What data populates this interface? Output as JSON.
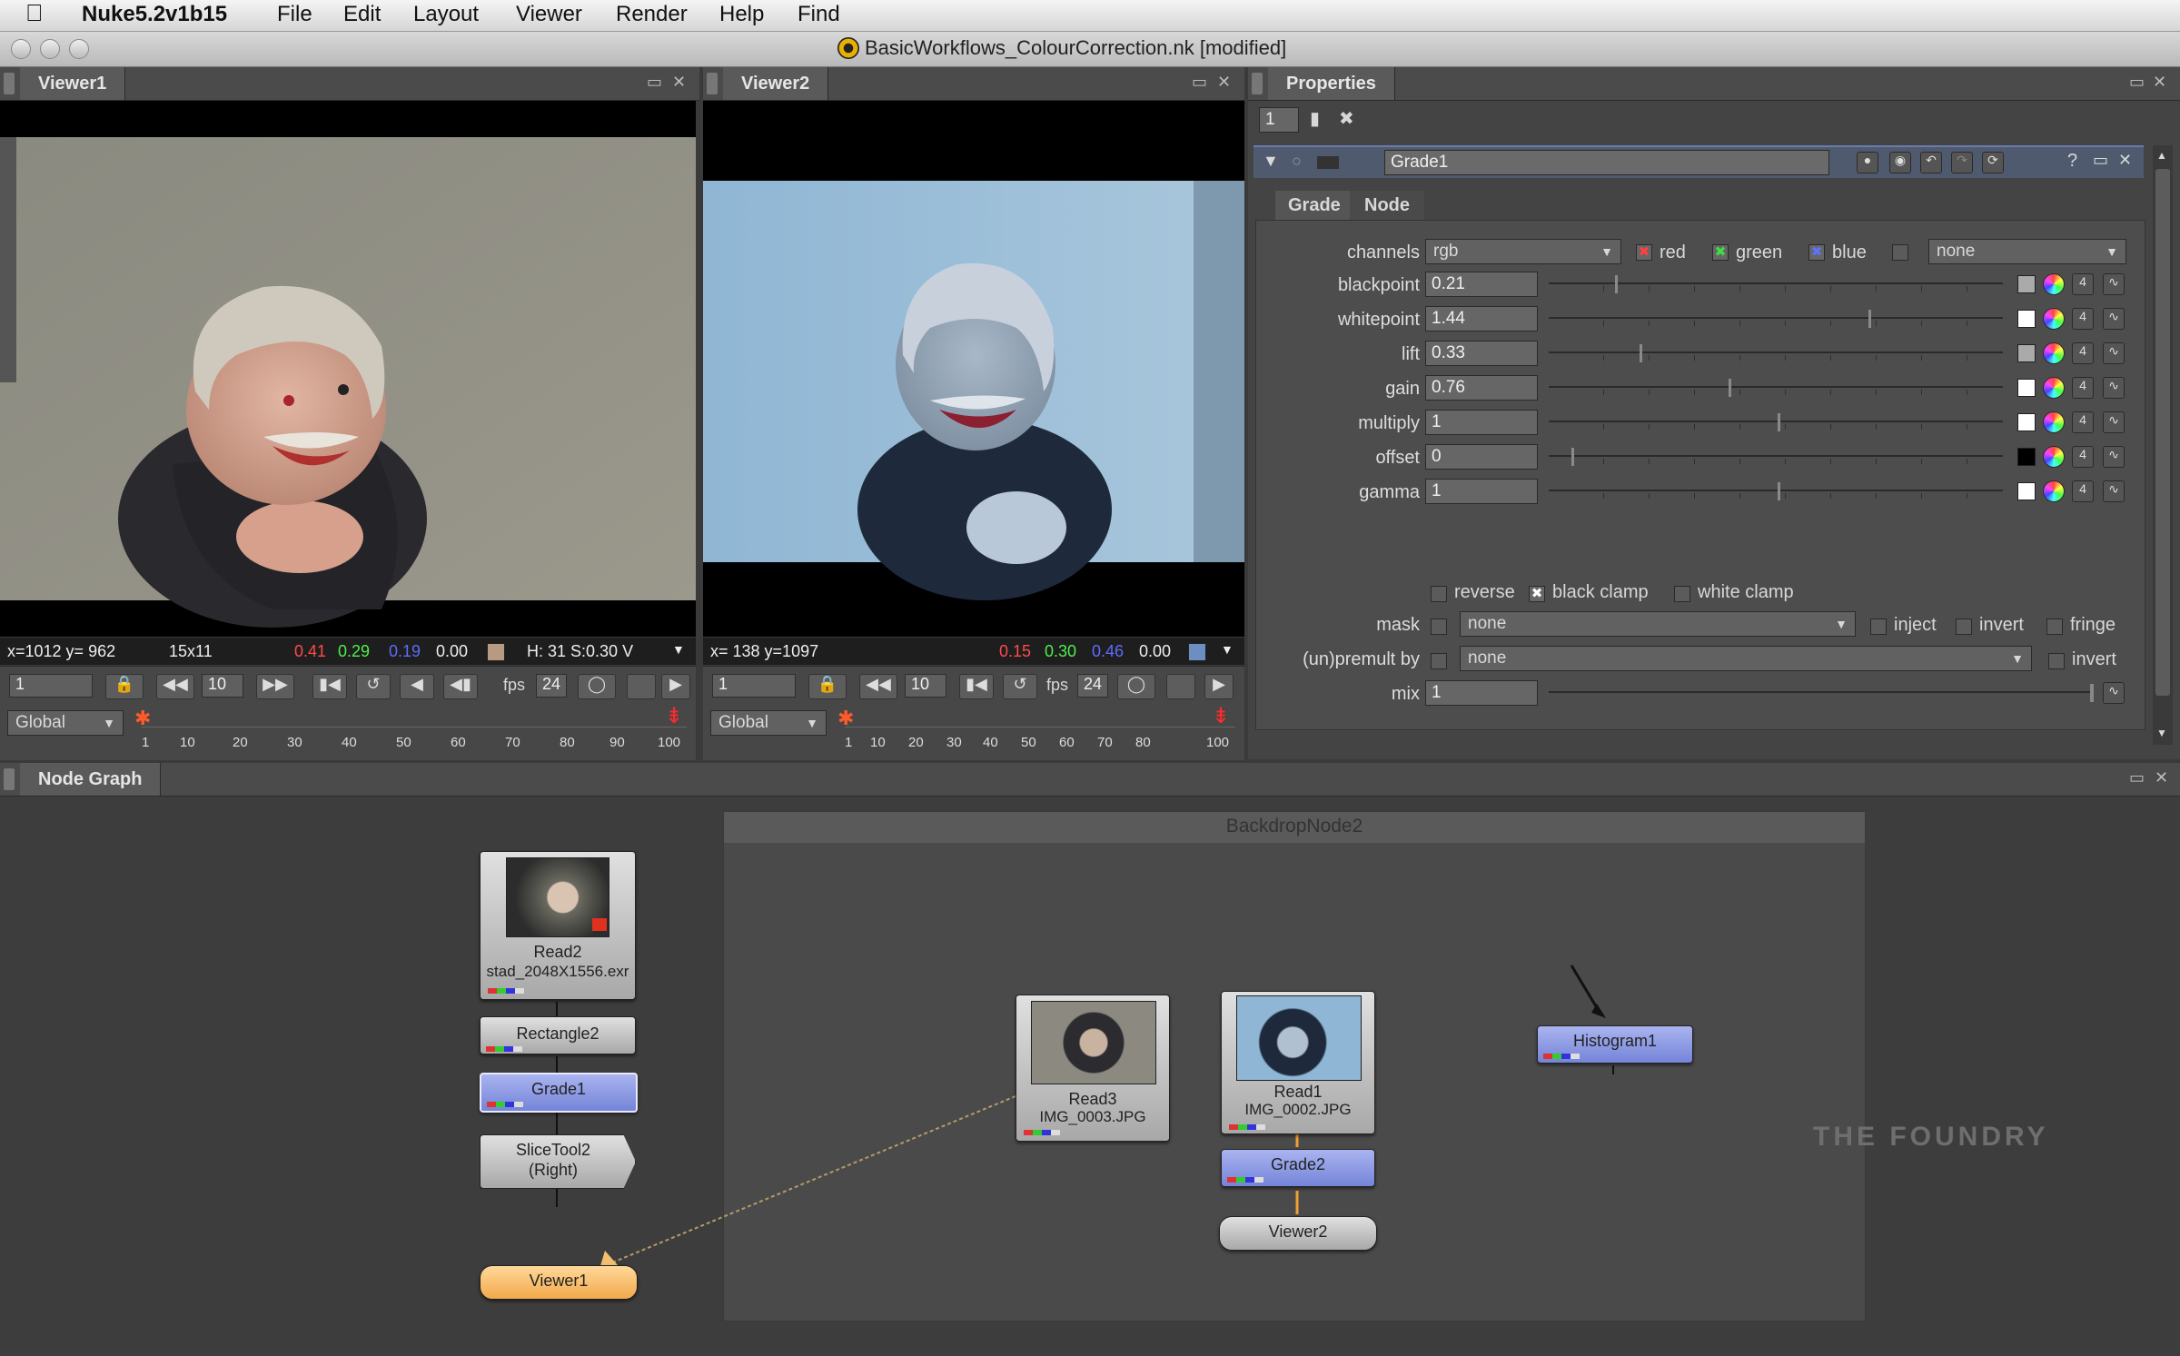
{
  "menubar": {
    "app": "Nuke5.2v1b15",
    "items": [
      "File",
      "Edit",
      "Layout",
      "Viewer",
      "Render",
      "Help",
      "Find"
    ]
  },
  "window": {
    "title": "BasicWorkflows_ColourCorrection.nk [modified]"
  },
  "viewer1": {
    "tab": "Viewer1",
    "coords": "x=1012 y= 962",
    "size": "15x11",
    "r": "0.41",
    "g": "0.29",
    "b": "0.19",
    "a": "0.00",
    "hsv": "H: 31 S:0.30 V",
    "frame": "1",
    "step": "10",
    "fps_label": "fps",
    "fps": "24",
    "scope": "Global",
    "ticks": [
      "1",
      "10",
      "20",
      "30",
      "40",
      "50",
      "60",
      "70",
      "80",
      "90",
      "100"
    ]
  },
  "viewer2": {
    "tab": "Viewer2",
    "coords": "x= 138 y=1097",
    "r": "0.15",
    "g": "0.30",
    "b": "0.46",
    "a": "0.00",
    "frame": "1",
    "step": "10",
    "fps_label": "fps",
    "fps": "24",
    "scope": "Global",
    "ticks": [
      "1",
      "10",
      "20",
      "30",
      "40",
      "50",
      "60",
      "70",
      "80",
      "100"
    ]
  },
  "properties": {
    "tab": "Properties",
    "max_panels": "1",
    "node_name": "Grade1",
    "tabs": [
      "Grade",
      "Node"
    ],
    "channels_label": "channels",
    "channels_value": "rgb",
    "ch_red": "red",
    "ch_green": "green",
    "ch_blue": "blue",
    "ch_extra": "none",
    "knobs": [
      {
        "label": "blackpoint",
        "value": "0.21"
      },
      {
        "label": "whitepoint",
        "value": "1.44"
      },
      {
        "label": "lift",
        "value": "0.33"
      },
      {
        "label": "gain",
        "value": "0.76"
      },
      {
        "label": "multiply",
        "value": "1"
      },
      {
        "label": "offset",
        "value": "0"
      },
      {
        "label": "gamma",
        "value": "1"
      }
    ],
    "reverse": "reverse",
    "black_clamp": "black clamp",
    "white_clamp": "white clamp",
    "mask_label": "mask",
    "mask_value": "none",
    "inject": "inject",
    "invert": "invert",
    "fringe": "fringe",
    "premult_label": "(un)premult by",
    "premult_value": "none",
    "premult_invert": "invert",
    "mix_label": "mix",
    "mix_value": "1"
  },
  "nodegraph": {
    "tab": "Node Graph",
    "backdrop": "BackdropNode2",
    "read2": {
      "name": "Read2",
      "file": "stad_2048X1556.exr"
    },
    "rectangle2": "Rectangle2",
    "grade1": "Grade1",
    "slicetool": {
      "line1": "SliceTool2",
      "line2": "(Right)"
    },
    "viewer1": "Viewer1",
    "read3": {
      "name": "Read3",
      "file": "IMG_0003.JPG"
    },
    "read1": {
      "name": "Read1",
      "file": "IMG_0002.JPG"
    },
    "grade2": "Grade2",
    "viewer2": "Viewer2",
    "histogram1": "Histogram1",
    "watermark": "THE FOUNDRY"
  }
}
